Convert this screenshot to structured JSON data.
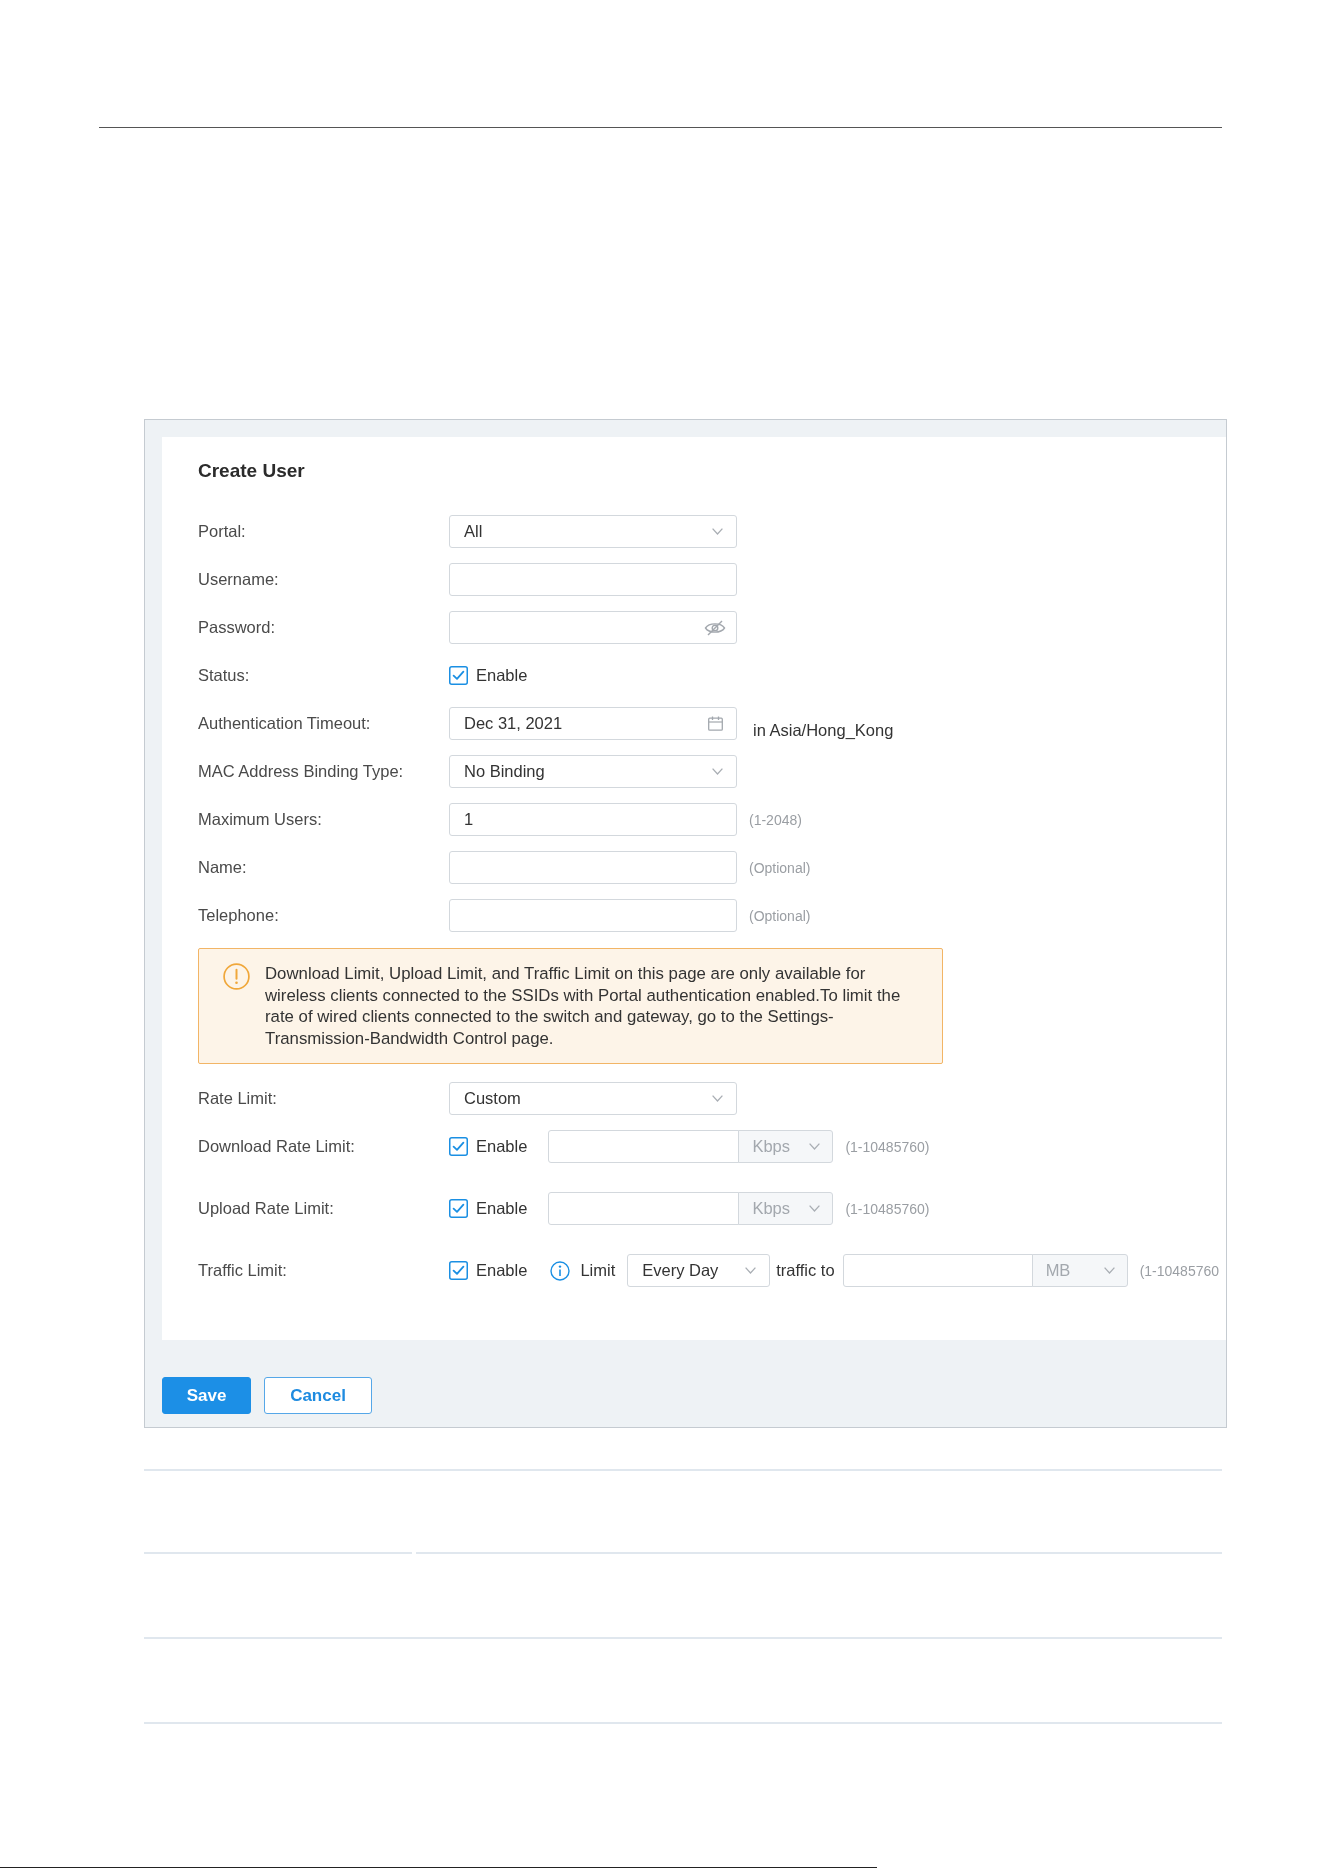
{
  "form": {
    "title": "Create User",
    "fields": [
      {
        "kind": "select",
        "label": "Portal:",
        "value": "All"
      },
      {
        "kind": "text",
        "label": "Username:"
      },
      {
        "kind": "password",
        "label": "Password:"
      },
      {
        "kind": "checkbox",
        "label": "Status:",
        "option": "Enable",
        "checked": true
      },
      {
        "kind": "date",
        "label": "Authentication Timeout:",
        "value": "Dec 31, 2021",
        "note": "in Asia/Hong_Kong"
      },
      {
        "kind": "select",
        "label": "MAC Address Binding Type:",
        "value": "No Binding"
      },
      {
        "kind": "text",
        "label": "Maximum Users:",
        "value": "1",
        "hint": "(1-2048)"
      },
      {
        "kind": "text",
        "label": "Name:",
        "hint": "(Optional)"
      },
      {
        "kind": "text",
        "label": "Telephone:",
        "hint": "(Optional)"
      }
    ],
    "notice": {
      "kind": "warning",
      "text": "Download Limit, Upload Limit, and Traffic Limit on this page are only available for wireless clients connected to the SSIDs with Portal authentication enabled.To limit the rate of wired clients connected to the switch and gateway, go to the Settings-Transmission-Bandwidth Control page."
    },
    "limits": [
      {
        "kind": "select",
        "label": "Rate Limit:",
        "value": "Custom"
      },
      {
        "kind": "rate",
        "label": "Download Rate Limit:",
        "option": "Enable",
        "checked": true,
        "unit": "Kbps",
        "hint": "(1-10485760)"
      },
      {
        "kind": "rate",
        "label": "Upload Rate Limit:",
        "option": "Enable",
        "checked": true,
        "unit": "Kbps",
        "hint": "(1-10485760)"
      },
      {
        "kind": "traffic",
        "label": "Traffic Limit:",
        "option": "Enable",
        "checked": true,
        "limit_text": "Limit",
        "period": "Every Day",
        "to_text": "traffic to",
        "unit": "MB",
        "hint": "(1-10485760"
      }
    ]
  },
  "buttons": [
    {
      "kind": "primary",
      "label": "Save"
    },
    {
      "kind": "secondary",
      "label": "Cancel"
    }
  ]
}
